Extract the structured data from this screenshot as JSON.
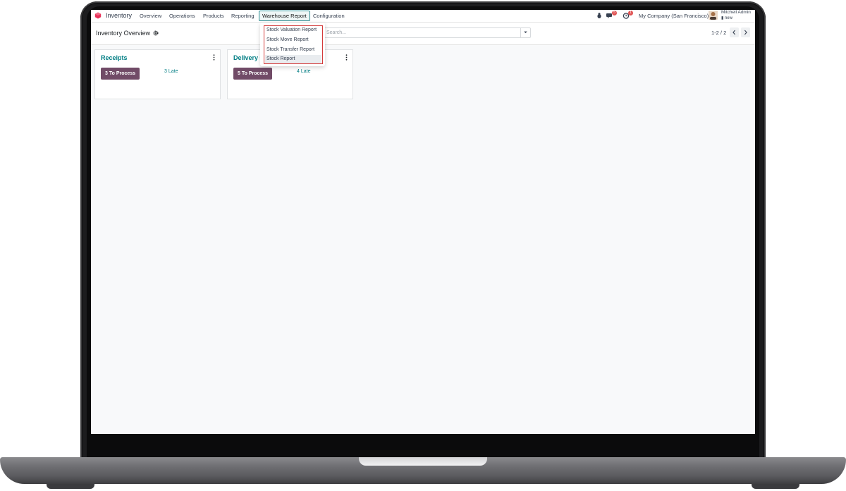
{
  "app": {
    "name": "Inventory"
  },
  "nav": {
    "menu": [
      "Overview",
      "Operations",
      "Products",
      "Reporting",
      "Warehouse Report",
      "Configuration"
    ],
    "messages_count": "5",
    "activities_count": "1",
    "company": "My Company (San Francisco)",
    "user_name": "Mitchell Admin",
    "user_db": "new"
  },
  "control": {
    "title": "Inventory Overview",
    "search_placeholder": "Search...",
    "pager": "1-2 / 2"
  },
  "dropdown": {
    "items": [
      "Stock Valuation Report",
      "Stock Move Report",
      "Stock Transfer Report",
      "Stock Report"
    ]
  },
  "cards": [
    {
      "title": "Receipts",
      "process_label": "3 To Process",
      "late_label": "3 Late"
    },
    {
      "title": "Delivery Orders",
      "process_label": "5 To Process",
      "late_label": "4 Late"
    }
  ],
  "colors": {
    "brand": "#714b67",
    "link": "#017e84",
    "highlight_frame": "#d33a3a"
  }
}
